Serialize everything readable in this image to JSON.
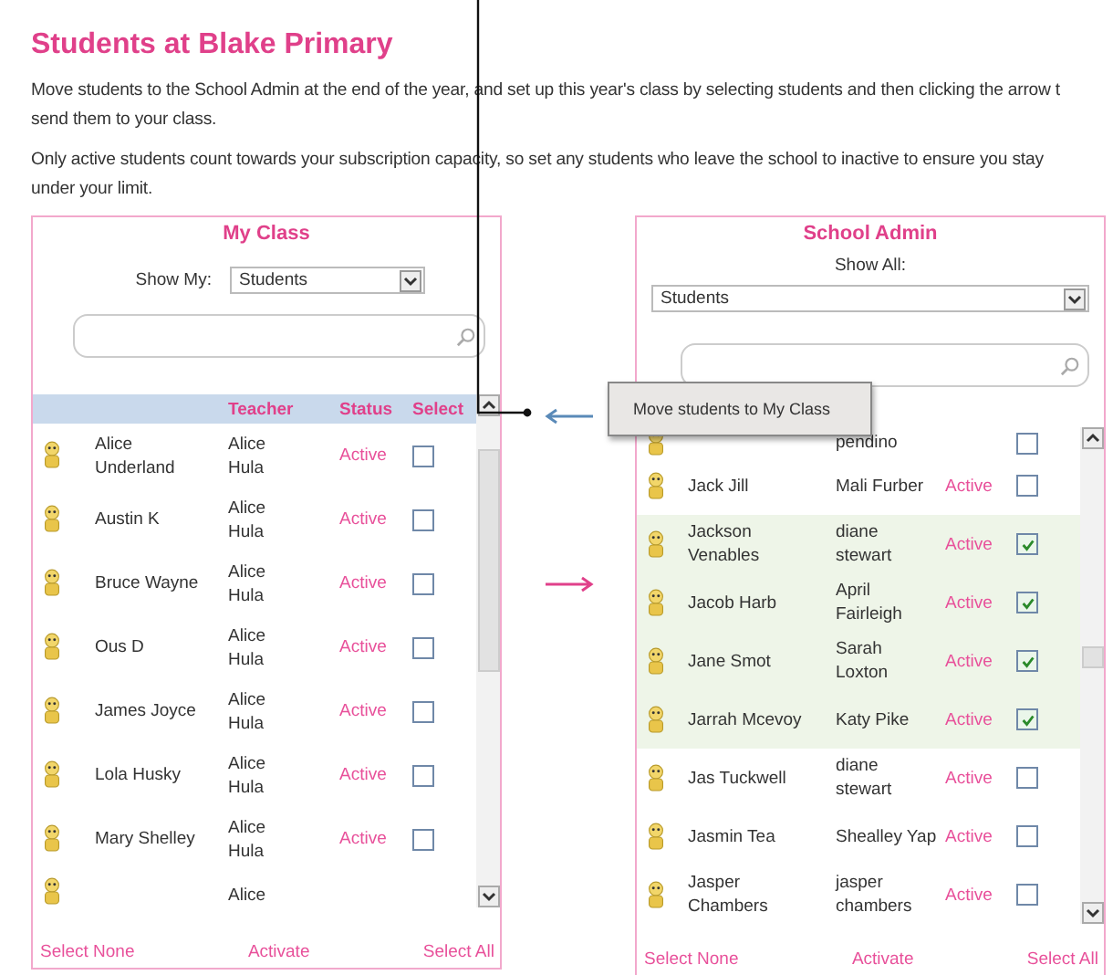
{
  "title": "Students at Blake Primary",
  "paragraphs": [
    "Move students to the School Admin at the end of the year, and set up this year's class by selecting students and then clicking the arrow t\nsend them to your class.",
    "Only active students count towards your subscription capacity, so set any students who leave the school to inactive to ensure you stay\nunder your limit."
  ],
  "panels": [
    {
      "title": "My Class",
      "filter": {
        "label": "Show My:",
        "value": "Students"
      },
      "columns": [
        "Teacher",
        "Status",
        "Select"
      ],
      "rows": [
        {
          "kind": "full",
          "name": "Alice Underland",
          "teacher": "Alice Hula",
          "status": "Active",
          "checked": false
        },
        {
          "kind": "full",
          "name": "Austin K",
          "teacher": "Alice Hula",
          "status": "Active",
          "checked": false
        },
        {
          "kind": "full",
          "name": "Bruce Wayne",
          "teacher": "Alice Hula",
          "status": "Active",
          "checked": false
        },
        {
          "kind": "full",
          "name": "Ous D",
          "teacher": "Alice Hula",
          "status": "Active",
          "checked": false
        },
        {
          "kind": "full",
          "name": "James Joyce",
          "teacher": "Alice Hula",
          "status": "Active",
          "checked": false
        },
        {
          "kind": "full",
          "name": "Lola Husky",
          "teacher": "Alice Hula",
          "status": "Active",
          "checked": false
        },
        {
          "kind": "full",
          "name": "Mary Shelley",
          "teacher": "Alice Hula",
          "status": "Active",
          "checked": false
        },
        {
          "kind": "partial",
          "teacher": "Alice"
        }
      ],
      "footer": [
        "Select None",
        "Activate",
        "Select All"
      ]
    },
    {
      "title": "School Admin",
      "filter": {
        "label": "Show All:",
        "value": "Students"
      },
      "rows": [
        {
          "kind": "partial",
          "teacher": "pendino",
          "checked": false
        },
        {
          "kind": "full",
          "name": "Jack Jill",
          "teacher": "Mali Furber",
          "status": "Active",
          "checked": false
        },
        {
          "kind": "full",
          "name": "Jackson Venables",
          "teacher": "diane stewart",
          "status": "Active",
          "checked": true
        },
        {
          "kind": "full",
          "name": "Jacob Harb",
          "teacher": "April Fairleigh",
          "status": "Active",
          "checked": true
        },
        {
          "kind": "full",
          "name": "Jane Smot",
          "teacher": "Sarah Loxton",
          "status": "Active",
          "checked": true
        },
        {
          "kind": "full",
          "name": "Jarrah Mcevoy",
          "teacher": "Katy Pike",
          "status": "Active",
          "checked": true
        },
        {
          "kind": "full",
          "name": "Jas Tuckwell",
          "teacher": "diane stewart",
          "status": "Active",
          "checked": false
        },
        {
          "kind": "full",
          "name": "Jasmin Tea",
          "teacher": "Shealley Yap",
          "status": "Active",
          "checked": false
        },
        {
          "kind": "full",
          "name": "Jasper Chambers",
          "teacher": "jasper chambers",
          "status": "Active",
          "checked": false
        }
      ],
      "footer": [
        "Select None",
        "Activate",
        "Select All"
      ]
    }
  ],
  "tooltip": {
    "text": "Move students to My Class"
  }
}
